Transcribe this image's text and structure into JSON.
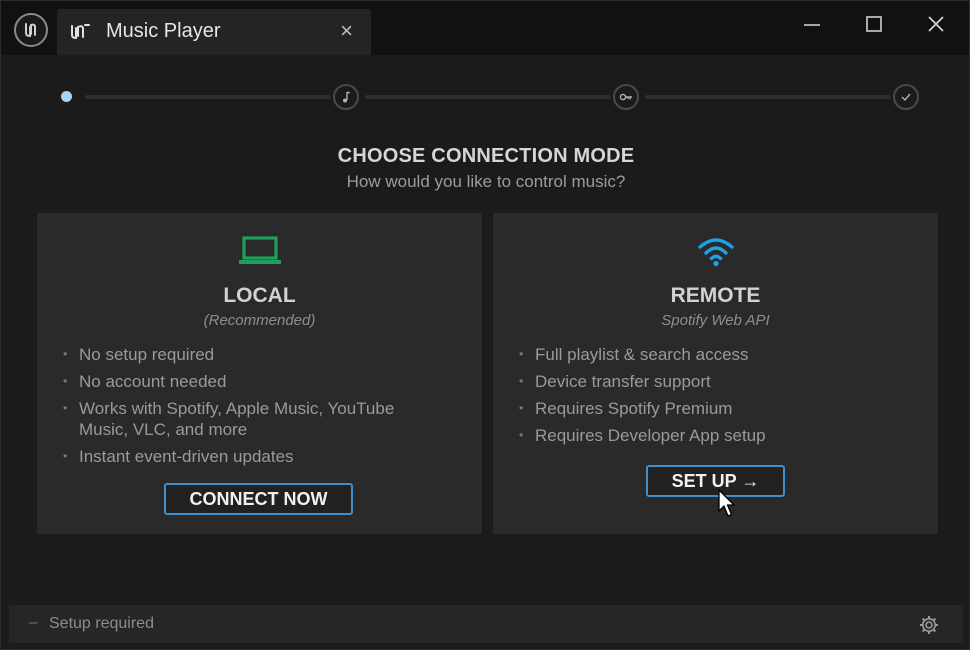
{
  "window": {
    "tab_title": "Music Player",
    "tab_close": "×"
  },
  "stepper": {
    "steps": [
      "active-step",
      "music-note-icon",
      "key-icon",
      "check-icon"
    ],
    "active_color": "#a7d3f5"
  },
  "main": {
    "heading": "CHOOSE CONNECTION MODE",
    "subheading": "How would you like to control music?"
  },
  "cards": {
    "local": {
      "icon": "laptop-icon",
      "icon_color": "#1fa05a",
      "title": "LOCAL",
      "subtitle": "(Recommended)",
      "features": [
        "No setup required",
        "No account needed",
        "Works with Spotify, Apple Music, YouTube Music, VLC, and more",
        "Instant event-driven updates"
      ],
      "button": "CONNECT NOW"
    },
    "remote": {
      "icon": "wifi-icon",
      "icon_color": "#1aa3e8",
      "title": "REMOTE",
      "subtitle": "Spotify Web API",
      "features": [
        "Full playlist & search access",
        "Device transfer support",
        "Requires Spotify Premium",
        "Requires Developer App setup"
      ],
      "button": "SET UP →"
    }
  },
  "status": {
    "indicator": "–",
    "text": "Setup required"
  },
  "colors": {
    "accent_border": "#3d8fce",
    "background": "#1b1b1b",
    "card": "#2a2a2a"
  }
}
